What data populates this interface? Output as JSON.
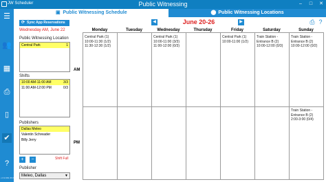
{
  "app": {
    "name": "JW Scheduler",
    "window_title": "Public Witnessing",
    "controls": [
      "–",
      "□",
      "✕"
    ]
  },
  "tabs": [
    {
      "label": "Public Witnessing Schedule",
      "icon": "calendar-check-icon",
      "active": true
    },
    {
      "label": "Public Witnessing Locations",
      "icon": "map-marker-icon",
      "active": false
    }
  ],
  "sidebar": {
    "icons": [
      "menu-icon",
      "people-icon",
      "calendar-icon",
      "printer-icon",
      "phone-icon",
      "person-check-icon",
      "help-icon"
    ],
    "version": "v.3.9.999.45.8"
  },
  "left_panel": {
    "sync_button": "Sync App Reservations",
    "date": "Wednesday AM, June 22",
    "locations_label": "Public Witnessing Location",
    "locations": [
      {
        "name": "Central Park",
        "count": "1"
      }
    ],
    "shifts_label": "Shifts",
    "shifts": [
      {
        "time": "10:00 AM-11:00 AM",
        "count": "3/3"
      },
      {
        "time": "11:00 AM-12:00 PM",
        "count": "0/3"
      }
    ],
    "publishers_label": "Publishers",
    "publishers": [
      "Dallas Meleo",
      "Valentin Schreader",
      "Billy Jerry"
    ],
    "add_button": "+",
    "remove_button": "−",
    "shift_full": "Shift Full",
    "publisher_label": "Publisher",
    "publisher_value": "Meleo, Dallas"
  },
  "schedule": {
    "prev": "◀",
    "next": "▶",
    "week": "June 20-26",
    "days": [
      "Monday",
      "Tuesday",
      "Wednesday",
      "Thursday",
      "Friday",
      "Saturday",
      "Sunday"
    ],
    "am_label": "AM",
    "pm_label": "PM",
    "am": [
      [
        "Central Park (1)",
        "10:00-11:30 (1/2)",
        "11:30-12:30 (1/2)"
      ],
      [],
      [
        "Central Park (1)",
        "10:00-11:00 (3/3)",
        "11:00-12:00 (0/3)"
      ],
      [],
      [
        "Central Park (1)",
        "10:00-11:00 (1/2)"
      ],
      [
        "Train Station -",
        "Entrance B (2)",
        "10:00-12:00 (0/3)"
      ],
      [
        "Train Station -",
        "Entrance B (2)",
        "10:00-12:00 (0/2)"
      ]
    ],
    "pm": [
      [],
      [],
      [],
      [],
      [],
      [],
      [
        "Train Station -",
        "Entrance B (2)",
        "2:00-3:00 (0/4)"
      ]
    ]
  }
}
